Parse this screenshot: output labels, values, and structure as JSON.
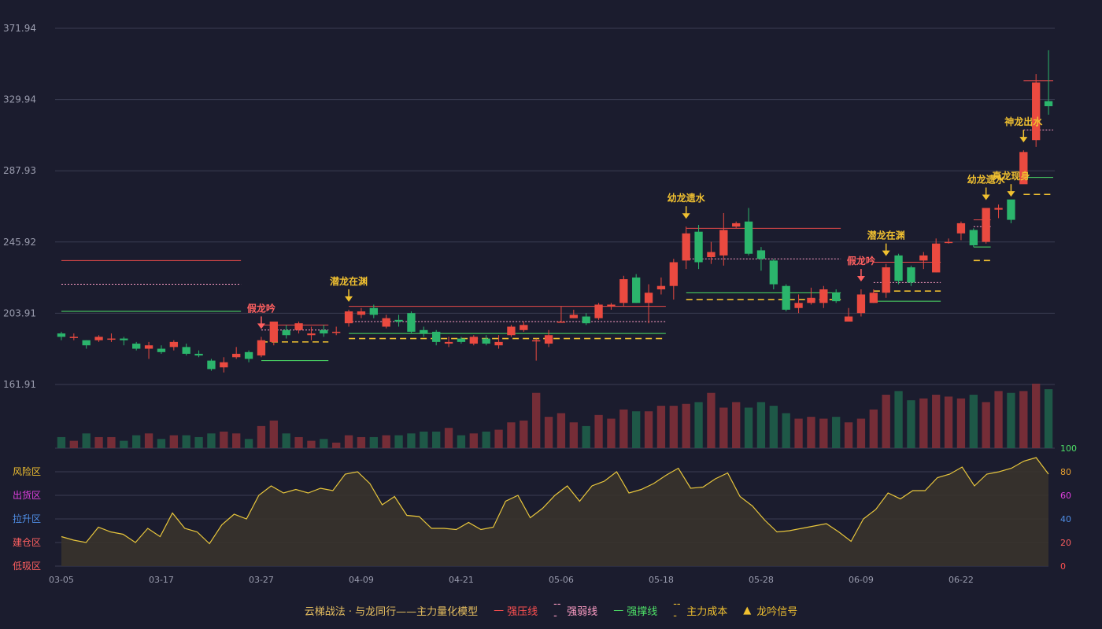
{
  "chart_data": {
    "type": "candlestick",
    "x_tick_labels": [
      "03-05",
      "03-17",
      "03-27",
      "04-09",
      "04-21",
      "05-06",
      "05-18",
      "05-28",
      "06-09",
      "06-22"
    ],
    "x_tick_index": [
      0,
      8,
      16,
      24,
      32,
      40,
      48,
      56,
      64,
      72
    ],
    "price_axis": {
      "min": 161.91,
      "max": 371.94,
      "ticks": [
        "371.94",
        "329.94",
        "287.93",
        "245.92",
        "203.91",
        "161.91"
      ]
    },
    "candles": [
      [
        192,
        190,
        193,
        188
      ],
      [
        190,
        190,
        192,
        188
      ],
      [
        188,
        185,
        188,
        183
      ],
      [
        188,
        190,
        191,
        187
      ],
      [
        189,
        189,
        192,
        187
      ],
      [
        189,
        188,
        190,
        185
      ],
      [
        186,
        183,
        187,
        182
      ],
      [
        183,
        185,
        187,
        177
      ],
      [
        183,
        181,
        185,
        180
      ],
      [
        184,
        187,
        188,
        182
      ],
      [
        184,
        180,
        186,
        179
      ],
      [
        180,
        179,
        182,
        178
      ],
      [
        176,
        171,
        177,
        170
      ],
      [
        172,
        175,
        178,
        169
      ],
      [
        178,
        180,
        184,
        177
      ],
      [
        181,
        177,
        182,
        175
      ],
      [
        179,
        188,
        190,
        178
      ],
      [
        187,
        199,
        199,
        185
      ],
      [
        194,
        191,
        197,
        189
      ],
      [
        194,
        198,
        199,
        192
      ],
      [
        191,
        192,
        196,
        188
      ],
      [
        194,
        192,
        197,
        190
      ],
      [
        193,
        193,
        196,
        191
      ],
      [
        198,
        205,
        206,
        196
      ],
      [
        203,
        205,
        207,
        201
      ],
      [
        207,
        203,
        209,
        201
      ],
      [
        196,
        201,
        203,
        195
      ],
      [
        200,
        199,
        203,
        196
      ],
      [
        204,
        193,
        205,
        192
      ],
      [
        194,
        192,
        196,
        190
      ],
      [
        193,
        187,
        194,
        185
      ],
      [
        186,
        187,
        190,
        184
      ],
      [
        189,
        187,
        190,
        186
      ],
      [
        186,
        190,
        191,
        185
      ],
      [
        189,
        186,
        191,
        185
      ],
      [
        185,
        187,
        191,
        183
      ],
      [
        191,
        196,
        197,
        190
      ],
      [
        194,
        197,
        199,
        193
      ],
      [
        188,
        188,
        189,
        176
      ],
      [
        186,
        191,
        194,
        184
      ],
      [
        199,
        199,
        208,
        199
      ],
      [
        201,
        203,
        206,
        201
      ],
      [
        202,
        198,
        204,
        197
      ],
      [
        201,
        209,
        210,
        200
      ],
      [
        208,
        209,
        210,
        206
      ],
      [
        210,
        224,
        226,
        208
      ],
      [
        225,
        210,
        227,
        210
      ],
      [
        210,
        216,
        221,
        198
      ],
      [
        218,
        220,
        225,
        215
      ],
      [
        220,
        234,
        236,
        212
      ],
      [
        235,
        251,
        255,
        230
      ],
      [
        252,
        234,
        256,
        230
      ],
      [
        237,
        240,
        246,
        233
      ],
      [
        238,
        253,
        263,
        232
      ],
      [
        255,
        257,
        258,
        254
      ],
      [
        258,
        239,
        266,
        238
      ],
      [
        241,
        236,
        243,
        229
      ],
      [
        235,
        221,
        236,
        218
      ],
      [
        220,
        206,
        221,
        205
      ],
      [
        207,
        210,
        215,
        204
      ],
      [
        210,
        213,
        219,
        209
      ],
      [
        210,
        218,
        220,
        207
      ],
      [
        216,
        211,
        218,
        210
      ],
      [
        199,
        202,
        207,
        199
      ],
      [
        204,
        215,
        218,
        202
      ],
      [
        210,
        216,
        218,
        210
      ],
      [
        216,
        231,
        233,
        213
      ],
      [
        238,
        223,
        239,
        221
      ],
      [
        231,
        222,
        232,
        220
      ],
      [
        235,
        238,
        240,
        230
      ],
      [
        228,
        245,
        248,
        228
      ],
      [
        246,
        246,
        248,
        245
      ],
      [
        251,
        257,
        258,
        247
      ],
      [
        253,
        244,
        254,
        243
      ],
      [
        246,
        266,
        266,
        245
      ],
      [
        265,
        266,
        268,
        260
      ],
      [
        271,
        259,
        268,
        257
      ],
      [
        280,
        299,
        300,
        281
      ],
      [
        306,
        340,
        345,
        302
      ],
      [
        329,
        326,
        359,
        321
      ]
    ],
    "levels": [
      {
        "name": "强压线",
        "color": "#e84a4a",
        "style": "solid",
        "segments": [
          [
            0,
            14,
            235
          ],
          [
            16,
            21,
            197
          ],
          [
            23,
            48,
            208
          ],
          [
            50,
            62,
            254
          ],
          [
            65,
            70,
            234
          ],
          [
            73,
            74,
            259
          ],
          [
            77,
            79,
            341
          ]
        ]
      },
      {
        "name": "强弱线",
        "color": "#ff9ec6",
        "style": "dotted",
        "segments": [
          [
            0,
            14,
            221
          ],
          [
            16,
            21,
            194
          ],
          [
            23,
            48,
            199
          ],
          [
            50,
            62,
            236
          ],
          [
            65,
            70,
            222
          ],
          [
            73,
            74,
            255
          ],
          [
            77,
            79,
            312
          ]
        ]
      },
      {
        "name": "强撑线",
        "color": "#4de067",
        "style": "solid",
        "segments": [
          [
            0,
            14,
            205
          ],
          [
            16,
            21,
            176
          ],
          [
            23,
            48,
            192
          ],
          [
            50,
            62,
            216
          ],
          [
            65,
            70,
            211
          ],
          [
            73,
            74,
            243
          ],
          [
            77,
            79,
            284
          ]
        ]
      },
      {
        "name": "主力成本",
        "color": "#f0c030",
        "style": "dashed",
        "segments": [
          [
            16,
            21,
            187
          ],
          [
            23,
            48,
            189
          ],
          [
            50,
            62,
            212
          ],
          [
            65,
            70,
            217
          ],
          [
            73,
            74,
            235
          ],
          [
            77,
            79,
            274
          ]
        ]
      }
    ],
    "signals": [
      {
        "index": 16,
        "label": "假龙吟",
        "color": "#ff6060"
      },
      {
        "index": 23,
        "label": "潜龙在渊",
        "color": "#f0c030"
      },
      {
        "index": 50,
        "label": "幼龙遗水",
        "color": "#f0c030"
      },
      {
        "index": 64,
        "label": "假龙吟",
        "color": "#ff6060"
      },
      {
        "index": 66,
        "label": "潜龙在渊",
        "color": "#f0c030"
      },
      {
        "index": 74,
        "label": "幼龙遗水",
        "color": "#f0c030"
      },
      {
        "index": 76,
        "label": "真龙现身",
        "color": "#f0c030"
      },
      {
        "index": 77,
        "label": "神龙出水",
        "color": "#f0c030"
      }
    ],
    "volume": [
      6,
      4,
      8,
      6,
      6,
      4,
      7,
      8,
      5,
      7,
      7,
      6,
      8,
      9,
      8,
      5,
      12,
      15,
      8,
      6,
      4,
      5,
      3,
      7,
      6,
      6,
      7,
      7,
      8,
      9,
      9,
      11,
      7,
      8,
      9,
      10,
      14,
      15,
      30,
      17,
      19,
      14,
      12,
      18,
      16,
      21,
      20,
      20,
      23,
      23,
      24,
      25,
      30,
      22,
      25,
      22,
      25,
      23,
      19,
      16,
      17,
      16,
      17,
      14,
      16,
      21,
      29,
      31,
      26,
      27,
      29,
      28,
      27,
      29,
      25,
      31,
      30,
      31,
      35,
      32
    ],
    "indicator": {
      "values": [
        25,
        22,
        20,
        33,
        29,
        27,
        20,
        32,
        25,
        45,
        32,
        29,
        19,
        35,
        44,
        40,
        60,
        68,
        62,
        65,
        62,
        66,
        64,
        78,
        80,
        70,
        52,
        59,
        43,
        42,
        32,
        32,
        31,
        37,
        31,
        33,
        55,
        60,
        41,
        49,
        60,
        68,
        55,
        68,
        72,
        80,
        62,
        65,
        70,
        77,
        83,
        66,
        67,
        74,
        79,
        59,
        51,
        39,
        29,
        30,
        32,
        34,
        36,
        29,
        21,
        40,
        48,
        62,
        57,
        64,
        64,
        75,
        78,
        84,
        68,
        78,
        80,
        83,
        89,
        92,
        78
      ],
      "axis_ticks": [
        "0",
        "20",
        "40",
        "60",
        "80",
        "100"
      ],
      "zones": [
        {
          "label": "风险区",
          "color": "#f0c030"
        },
        {
          "label": "出货区",
          "color": "#e040e0"
        },
        {
          "label": "拉升区",
          "color": "#4f8ee6"
        },
        {
          "label": "建仓区",
          "color": "#ff6060"
        },
        {
          "label": "低吸区",
          "color": "#ff6060"
        }
      ]
    }
  },
  "legend": {
    "title": "云梯战法 · 与龙同行——主力量化模型",
    "items": [
      {
        "symbol": "—",
        "label": "强压线",
        "color": "#ff5050"
      },
      {
        "symbol": "---",
        "label": "强弱线",
        "color": "#ff9ec6"
      },
      {
        "symbol": "—",
        "label": "强撑线",
        "color": "#4de067"
      },
      {
        "symbol": "---",
        "label": "主力成本",
        "color": "#f0c030"
      },
      {
        "symbol": "▲",
        "label": "龙吟信号",
        "color": "#f0c030"
      }
    ]
  },
  "colors": {
    "up": "#ea4a40",
    "down": "#2bb56c",
    "grid": "#3b3d52",
    "axis_text": "#9a9cae",
    "line": "#e8c63c"
  }
}
